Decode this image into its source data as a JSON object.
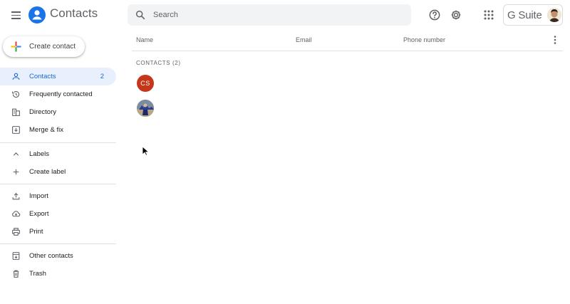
{
  "app": {
    "title": "Contacts",
    "brand_color": "#1a73e8"
  },
  "header": {
    "menu_icon": "hamburger-menu-icon",
    "search": {
      "placeholder": "Search",
      "value": ""
    },
    "help_icon": "help-icon",
    "settings_icon": "settings-gear-icon",
    "apps_icon": "apps-grid-icon",
    "suite_label": "G Suite"
  },
  "sidebar": {
    "create_label": "Create contact",
    "items": [
      {
        "label": "Contacts",
        "count": "2",
        "icon": "person-icon",
        "active": true
      },
      {
        "label": "Frequently contacted",
        "icon": "history-icon"
      },
      {
        "label": "Directory",
        "icon": "building-icon"
      },
      {
        "label": "Merge & fix",
        "icon": "merge-icon"
      }
    ],
    "labels": {
      "heading": "Labels",
      "create_label": "Create label"
    },
    "tools": [
      {
        "label": "Import",
        "icon": "upload-icon"
      },
      {
        "label": "Export",
        "icon": "cloud-download-icon"
      },
      {
        "label": "Print",
        "icon": "printer-icon"
      }
    ],
    "other": [
      {
        "label": "Other contacts",
        "icon": "archive-icon"
      },
      {
        "label": "Trash",
        "icon": "trash-icon"
      }
    ],
    "active_bg": "#e8f0fe",
    "active_color": "#1967d2"
  },
  "table": {
    "columns": [
      "Name",
      "Email",
      "Phone number"
    ],
    "section_label": "CONTACTS (2)",
    "contacts": [
      {
        "initials": "CS",
        "color": "#c6361b"
      },
      {
        "initials": "",
        "photo": true
      }
    ]
  }
}
